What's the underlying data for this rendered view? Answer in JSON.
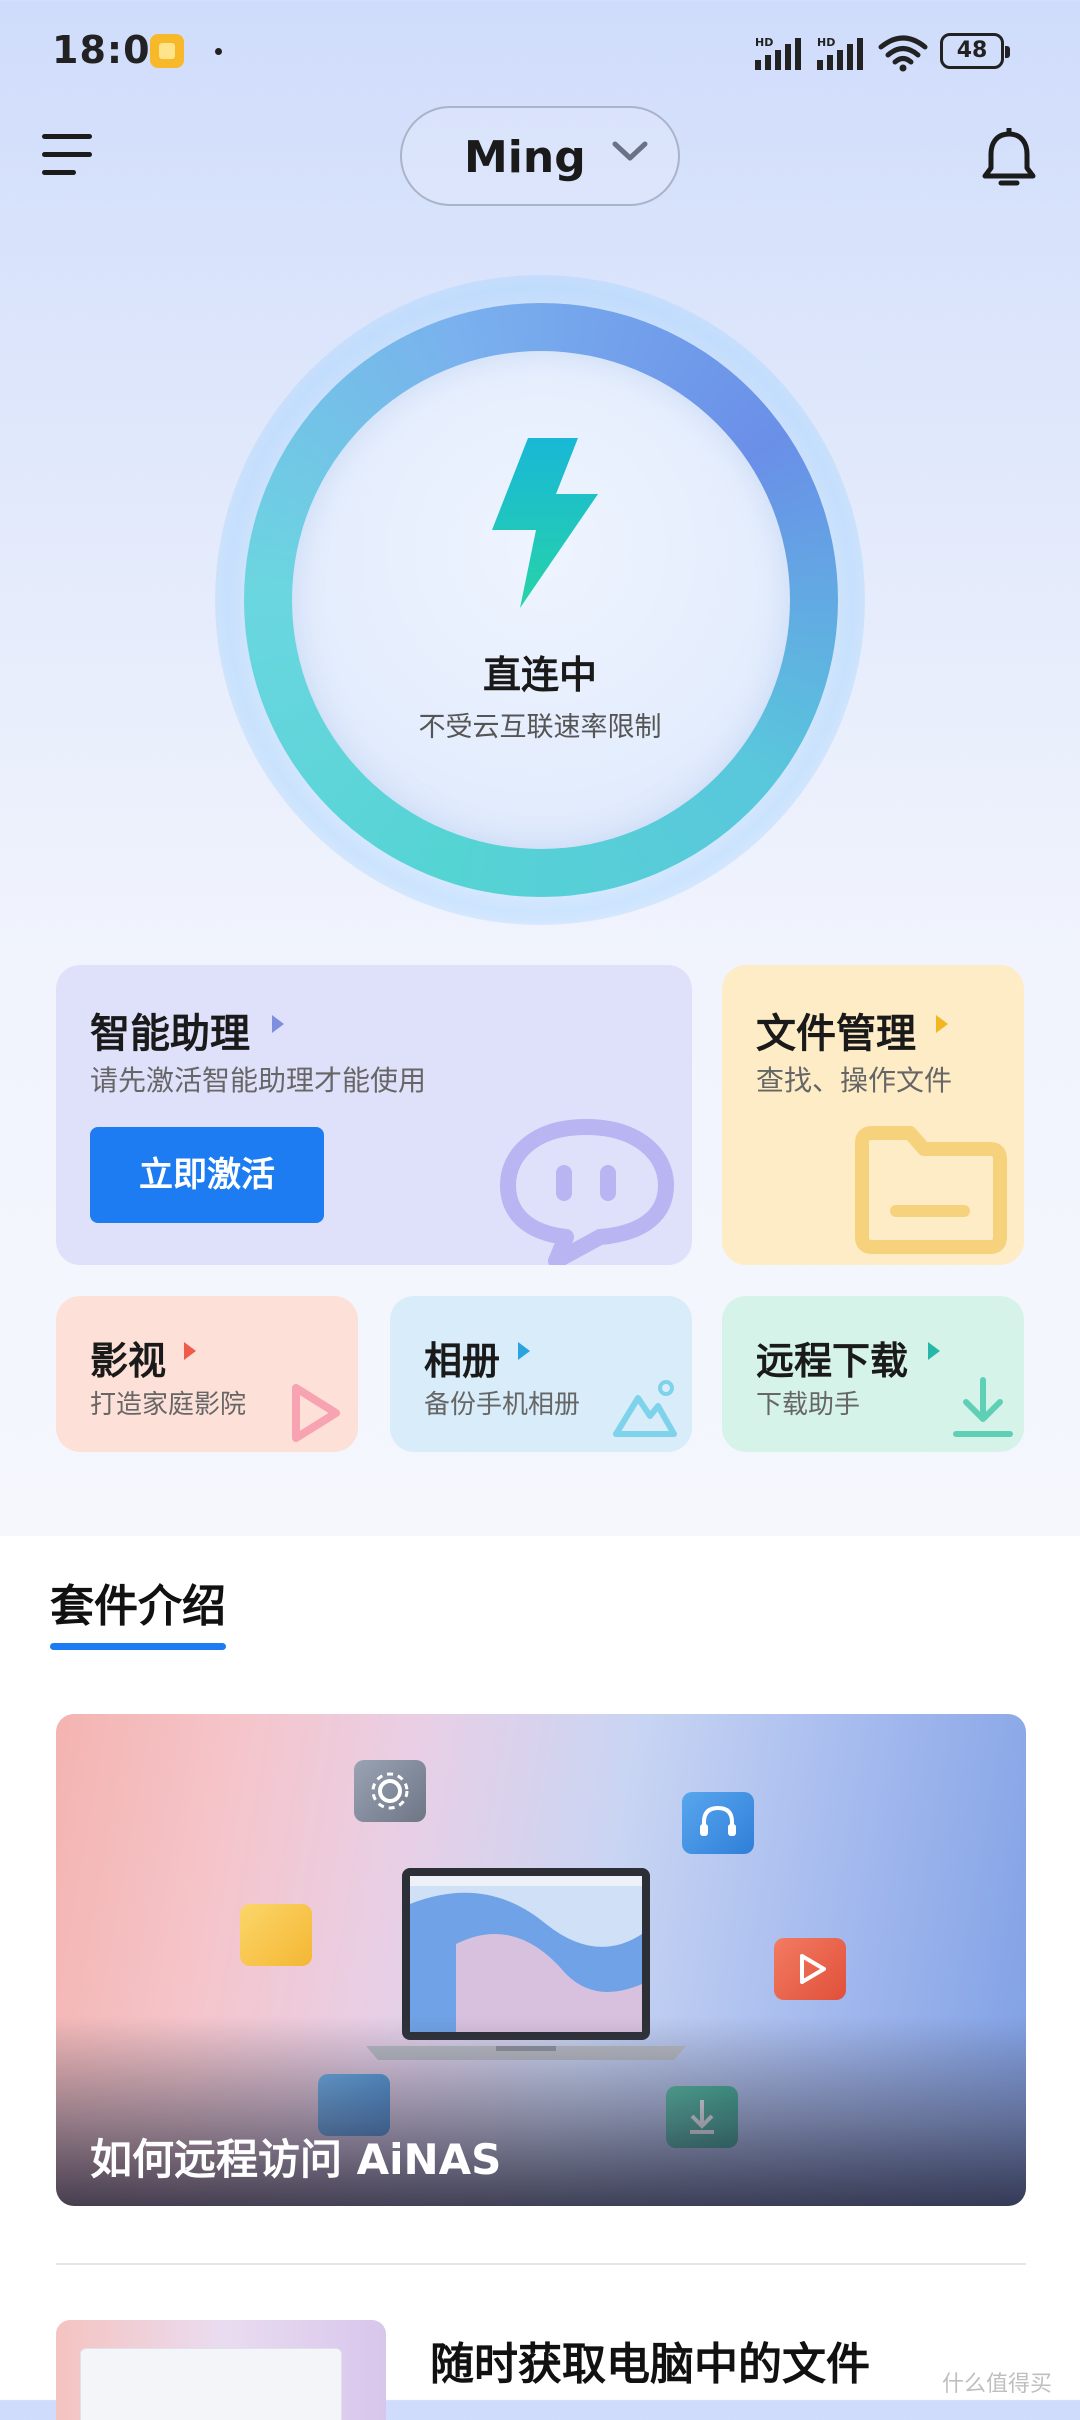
{
  "status_bar": {
    "time": "18:01",
    "battery": "48",
    "network_label": "HD"
  },
  "header": {
    "account_name": "Ming"
  },
  "connection": {
    "title": "直连中",
    "subtitle": "不受云互联速率限制"
  },
  "cards": {
    "ai": {
      "title": "智能助理",
      "subtitle": "请先激活智能助理才能使用",
      "button": "立即激活"
    },
    "file": {
      "title": "文件管理",
      "subtitle": "查找、操作文件"
    },
    "video": {
      "title": "影视",
      "subtitle": "打造家庭影院"
    },
    "photo": {
      "title": "相册",
      "subtitle": "备份手机相册"
    },
    "download": {
      "title": "远程下载",
      "subtitle": "下载助手"
    }
  },
  "suite": {
    "title": "套件介绍",
    "articles": [
      {
        "title": "如何远程访问 AiNAS"
      },
      {
        "title": "随时获取电脑中的文件"
      }
    ]
  },
  "watermark": "什么值得买",
  "colors": {
    "accent": "#1e7cf2",
    "ai_card": "#dfe1fb",
    "file_card": "#fdecc6",
    "video_card": "#fde0d8",
    "photo_card": "#d8ecfa",
    "download_card": "#d6f3ea"
  }
}
